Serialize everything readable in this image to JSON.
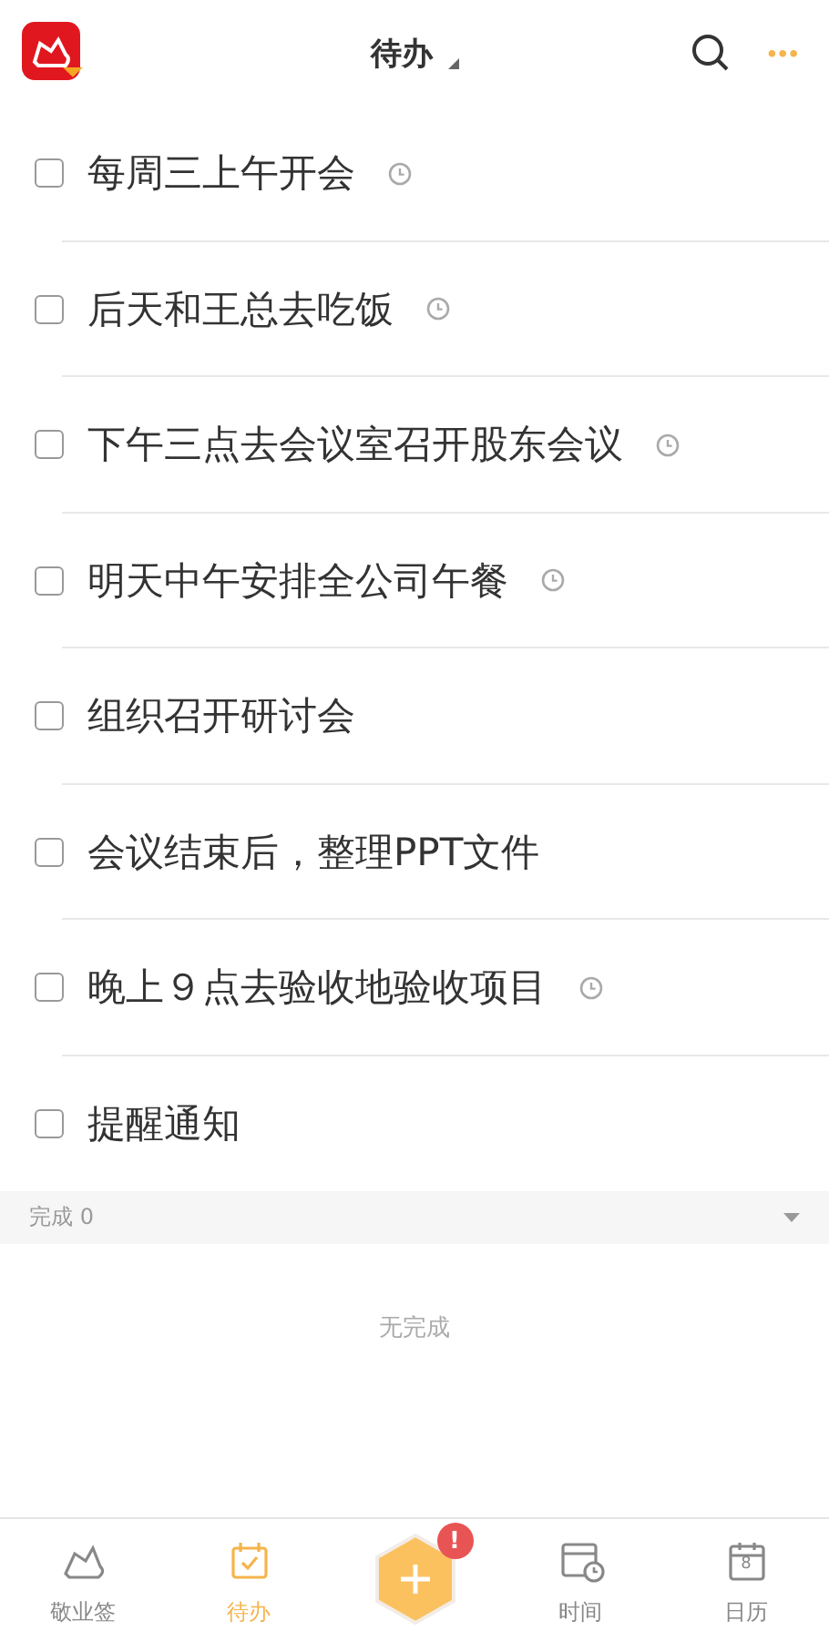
{
  "header": {
    "title": "待办",
    "menu": "•••"
  },
  "tasks": [
    {
      "title": "每周三上午开会",
      "checked": false,
      "reminder": true
    },
    {
      "title": "后天和王总去吃饭",
      "checked": false,
      "reminder": true
    },
    {
      "title": "下午三点去会议室召开股东会议",
      "checked": false,
      "reminder": true
    },
    {
      "title": "明天中午安排全公司午餐",
      "checked": false,
      "reminder": true
    },
    {
      "title": "组织召开研讨会",
      "checked": false,
      "reminder": false
    },
    {
      "title": "会议结束后，整理PPT文件",
      "checked": false,
      "reminder": false
    },
    {
      "title": "晚上９点去验收地验收项目",
      "checked": false,
      "reminder": true
    },
    {
      "title": "提醒通知",
      "checked": false,
      "reminder": false
    }
  ],
  "completed": {
    "label": "完成",
    "count": "0",
    "expanded": false,
    "empty_text": "无完成"
  },
  "nav": [
    {
      "kind": "notes",
      "label": "敬业签",
      "selected": false
    },
    {
      "kind": "todo",
      "label": "待办",
      "selected": true
    },
    {
      "kind": "add",
      "badge": "!"
    },
    {
      "kind": "time",
      "label": "时间",
      "selected": false
    },
    {
      "kind": "calendar",
      "label": "日历",
      "selected": false,
      "day": "8"
    }
  ]
}
